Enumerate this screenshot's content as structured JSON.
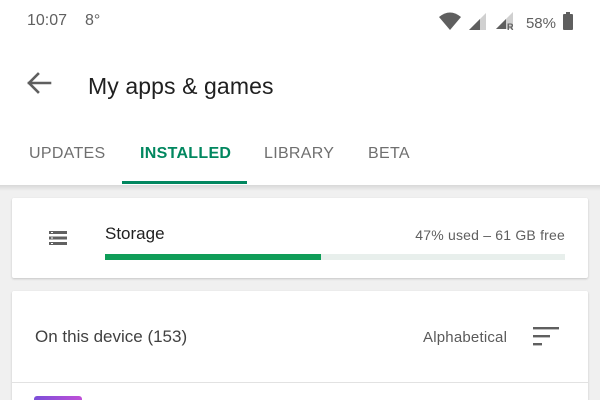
{
  "status_bar": {
    "time": "10:07",
    "temperature": "8°",
    "battery_percent": "58%",
    "network_label": "R",
    "icons": [
      "wifi-icon",
      "signal-icon",
      "signal-roaming-icon",
      "battery-icon"
    ]
  },
  "toolbar": {
    "back_icon": "arrow-back-icon",
    "title": "My apps & games"
  },
  "tabs": [
    {
      "label": "UPDATES",
      "active": false
    },
    {
      "label": "INSTALLED",
      "active": true
    },
    {
      "label": "LIBRARY",
      "active": false
    },
    {
      "label": "BETA",
      "active": false
    }
  ],
  "storage": {
    "icon": "storage-icon",
    "label": "Storage",
    "stats": "47% used – 61 GB free",
    "used_fraction": 0.47
  },
  "device": {
    "title": "On this device (153)",
    "sort_label": "Alphabetical",
    "sort_icon": "sort-icon"
  },
  "colors": {
    "accent": "#01875f",
    "storage_bar": "#0f9d58",
    "background": "#f0f0f0"
  }
}
